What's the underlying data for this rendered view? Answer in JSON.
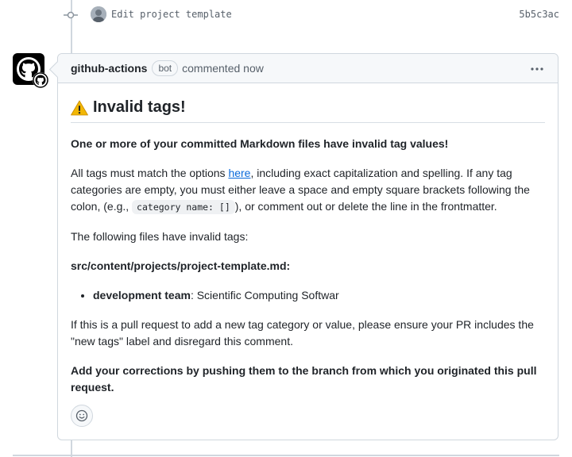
{
  "commit": {
    "message": "Edit project template",
    "sha": "5b5c3ac"
  },
  "comment": {
    "author": "github-actions",
    "badge": "bot",
    "timestamp": "commented now",
    "heading": "Invalid tags!",
    "intro_bold": "One or more of your committed Markdown files have invalid tag values!",
    "p1_before": "All tags must match the options ",
    "p1_link": "here",
    "p1_middle": ", including exact capitalization and spelling. If any tag categories are empty, you must either leave a space and empty square brackets following the colon, (e.g., ",
    "p1_code": "category name: []",
    "p1_after": "), or comment out or delete the line in the frontmatter.",
    "p2": "The following files have invalid tags:",
    "file_path": "src/content/projects/project-template.md:",
    "invalid_items": [
      {
        "key": "development team",
        "value": ": Scientific Computing Softwar"
      }
    ],
    "p3": "If this is a pull request to add a new tag category or value, please ensure your PR includes the \"new tags\" label and disregard this comment.",
    "closing_bold": "Add your corrections by pushing them to the branch from which you originated this pull request."
  },
  "icons": {
    "commit": "git-commit-icon",
    "avatar": "github-logo-icon",
    "warning": "warning-icon",
    "menu": "kebab-horizontal-icon",
    "reaction": "smiley-icon"
  },
  "colors": {
    "link": "#0969da",
    "border": "#d0d7de",
    "header_bg": "#f6f8fa",
    "muted": "#57606a",
    "warning": "#e3a008"
  }
}
